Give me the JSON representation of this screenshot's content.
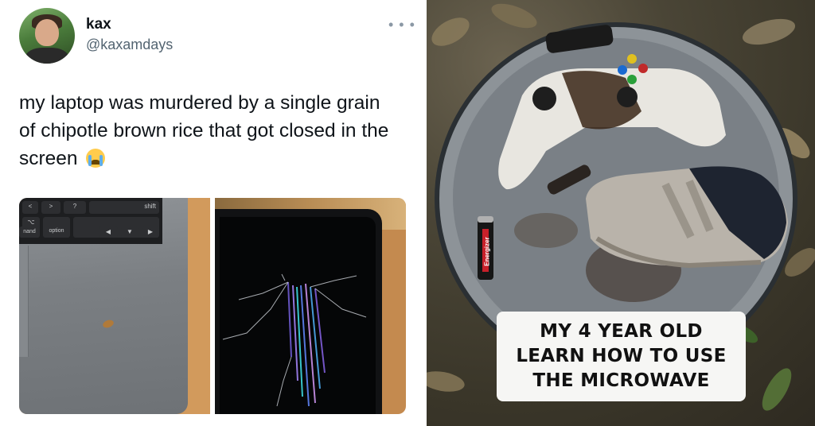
{
  "tweet": {
    "display_name": "kax",
    "handle": "@kaxamdays",
    "text": "my laptop was murdered by a single grain of chipotle brown rice that got closed in the screen",
    "emoji_icon": "loudly-crying-face-icon",
    "more_icon": "more-options-icon",
    "keyboard_keys": [
      "<",
      ">",
      "?",
      "shift",
      "⌥",
      "nand",
      "option"
    ]
  },
  "meme": {
    "caption": "MY 4 YEAR OLD\nLEARN HOW TO USE\nTHE MICROWAVE",
    "battery_brand": "Energizer"
  },
  "colors": {
    "tweet_text": "#0f1419",
    "handle_gray": "#536471",
    "caption_bg": "#f6f6f4"
  }
}
